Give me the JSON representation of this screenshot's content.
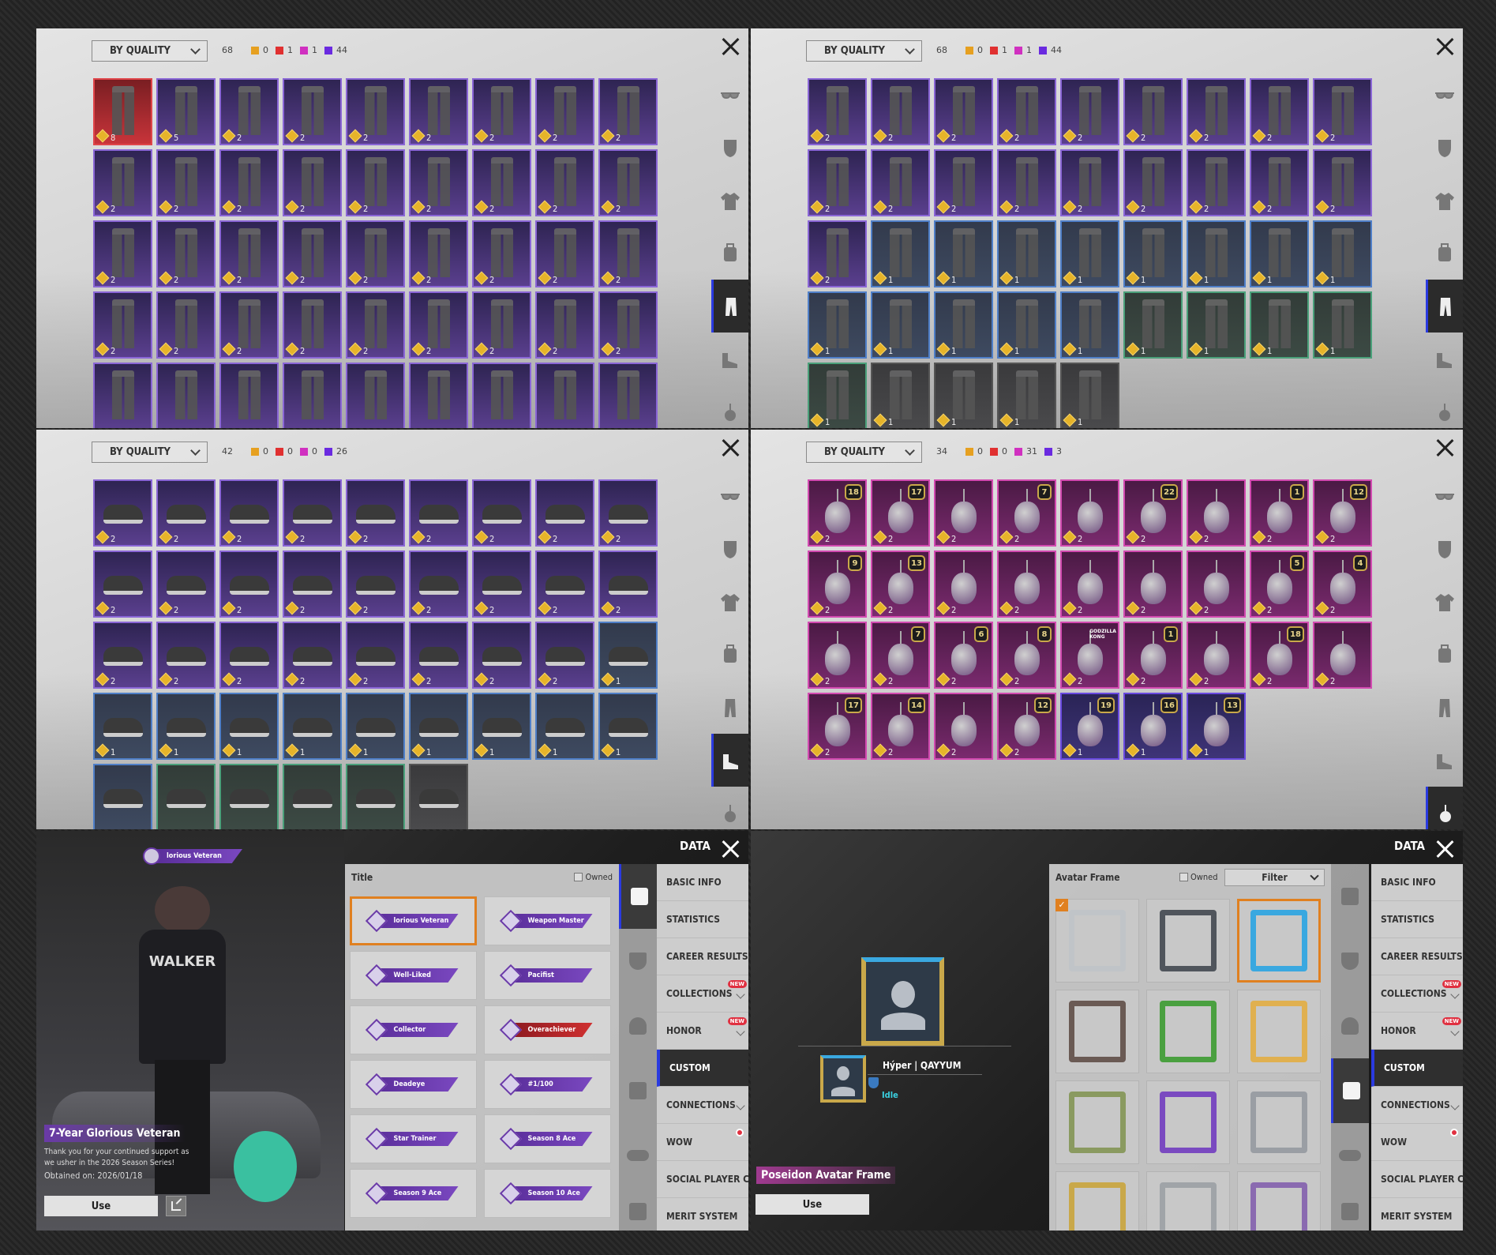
{
  "colors": {
    "accent": "#2a3ae0",
    "selected_border": "#e08020",
    "legend": [
      "#e6a020",
      "#e03030",
      "#d030c0",
      "#6a2ae0"
    ]
  },
  "side_icons": [
    "glasses-icon",
    "mask-icon",
    "jacket-icon",
    "backpack-icon",
    "pants-icon",
    "shoes-icon",
    "pendant-icon"
  ],
  "inventory_panels": [
    {
      "sort_label": "BY QUALITY",
      "total": "68",
      "counts": [
        "0",
        "1",
        "1",
        "44"
      ],
      "selected_category": 4,
      "kind": "pants",
      "items": [
        {
          "q": "r",
          "n": "8"
        },
        {
          "q": "p",
          "n": "5"
        },
        {
          "q": "p",
          "n": "2"
        },
        {
          "q": "p",
          "n": "2"
        },
        {
          "q": "p",
          "n": "2"
        },
        {
          "q": "p",
          "n": "2"
        },
        {
          "q": "p",
          "n": "2"
        },
        {
          "q": "p",
          "n": "2"
        },
        {
          "q": "p",
          "n": "2"
        },
        {
          "q": "p",
          "n": "2"
        },
        {
          "q": "p",
          "n": "2"
        },
        {
          "q": "p",
          "n": "2"
        },
        {
          "q": "p",
          "n": "2"
        },
        {
          "q": "p",
          "n": "2"
        },
        {
          "q": "p",
          "n": "2"
        },
        {
          "q": "p",
          "n": "2"
        },
        {
          "q": "p",
          "n": "2"
        },
        {
          "q": "p",
          "n": "2"
        },
        {
          "q": "p",
          "n": "2"
        },
        {
          "q": "p",
          "n": "2"
        },
        {
          "q": "p",
          "n": "2"
        },
        {
          "q": "p",
          "n": "2"
        },
        {
          "q": "p",
          "n": "2"
        },
        {
          "q": "p",
          "n": "2"
        },
        {
          "q": "p",
          "n": "2"
        },
        {
          "q": "p",
          "n": "2"
        },
        {
          "q": "p",
          "n": "2"
        },
        {
          "q": "p",
          "n": "2"
        },
        {
          "q": "p",
          "n": "2"
        },
        {
          "q": "p",
          "n": "2"
        },
        {
          "q": "p",
          "n": "2"
        },
        {
          "q": "p",
          "n": "2"
        },
        {
          "q": "p",
          "n": "2"
        },
        {
          "q": "p",
          "n": "2"
        },
        {
          "q": "p",
          "n": "2"
        },
        {
          "q": "p",
          "n": "2"
        },
        {
          "q": "p"
        },
        {
          "q": "p"
        },
        {
          "q": "p"
        },
        {
          "q": "p"
        },
        {
          "q": "p"
        },
        {
          "q": "p"
        },
        {
          "q": "p"
        },
        {
          "q": "p"
        },
        {
          "q": "p"
        }
      ]
    },
    {
      "sort_label": "BY QUALITY",
      "total": "68",
      "counts": [
        "0",
        "1",
        "1",
        "44"
      ],
      "selected_category": 4,
      "kind": "pants",
      "items": [
        {
          "q": "p",
          "n": "2"
        },
        {
          "q": "p",
          "n": "2"
        },
        {
          "q": "p",
          "n": "2"
        },
        {
          "q": "p",
          "n": "2"
        },
        {
          "q": "p",
          "n": "2"
        },
        {
          "q": "p",
          "n": "2"
        },
        {
          "q": "p",
          "n": "2"
        },
        {
          "q": "p",
          "n": "2"
        },
        {
          "q": "p",
          "n": "2"
        },
        {
          "q": "p",
          "n": "2"
        },
        {
          "q": "p",
          "n": "2"
        },
        {
          "q": "p",
          "n": "2"
        },
        {
          "q": "p",
          "n": "2"
        },
        {
          "q": "p",
          "n": "2"
        },
        {
          "q": "p",
          "n": "2"
        },
        {
          "q": "p",
          "n": "2"
        },
        {
          "q": "p",
          "n": "2"
        },
        {
          "q": "p",
          "n": "2"
        },
        {
          "q": "p",
          "n": "2"
        },
        {
          "q": "b",
          "n": "1"
        },
        {
          "q": "b",
          "n": "1"
        },
        {
          "q": "b",
          "n": "1"
        },
        {
          "q": "b",
          "n": "1"
        },
        {
          "q": "b",
          "n": "1"
        },
        {
          "q": "b",
          "n": "1"
        },
        {
          "q": "b",
          "n": "1"
        },
        {
          "q": "b",
          "n": "1"
        },
        {
          "q": "b",
          "n": "1"
        },
        {
          "q": "b",
          "n": "1"
        },
        {
          "q": "b",
          "n": "1"
        },
        {
          "q": "b",
          "n": "1"
        },
        {
          "q": "b",
          "n": "1"
        },
        {
          "q": "g",
          "n": "1"
        },
        {
          "q": "g",
          "n": "1"
        },
        {
          "q": "g",
          "n": "1"
        },
        {
          "q": "g",
          "n": "1"
        },
        {
          "q": "g",
          "n": "1"
        },
        {
          "q": "x",
          "n": "1"
        },
        {
          "q": "x",
          "n": "1"
        },
        {
          "q": "x",
          "n": "1"
        },
        {
          "q": "x",
          "n": "1"
        }
      ]
    },
    {
      "sort_label": "BY QUALITY",
      "total": "42",
      "counts": [
        "0",
        "0",
        "0",
        "26"
      ],
      "selected_category": 5,
      "kind": "shoes",
      "items": [
        {
          "q": "p",
          "n": "2"
        },
        {
          "q": "p",
          "n": "2"
        },
        {
          "q": "p",
          "n": "2"
        },
        {
          "q": "p",
          "n": "2"
        },
        {
          "q": "p",
          "n": "2"
        },
        {
          "q": "p",
          "n": "2"
        },
        {
          "q": "p",
          "n": "2"
        },
        {
          "q": "p",
          "n": "2"
        },
        {
          "q": "p",
          "n": "2"
        },
        {
          "q": "p",
          "n": "2"
        },
        {
          "q": "p",
          "n": "2"
        },
        {
          "q": "p",
          "n": "2"
        },
        {
          "q": "p",
          "n": "2"
        },
        {
          "q": "p",
          "n": "2"
        },
        {
          "q": "p",
          "n": "2"
        },
        {
          "q": "p",
          "n": "2"
        },
        {
          "q": "p",
          "n": "2"
        },
        {
          "q": "p",
          "n": "2"
        },
        {
          "q": "p",
          "n": "2"
        },
        {
          "q": "p",
          "n": "2"
        },
        {
          "q": "p",
          "n": "2"
        },
        {
          "q": "p",
          "n": "2"
        },
        {
          "q": "p",
          "n": "2"
        },
        {
          "q": "p",
          "n": "2"
        },
        {
          "q": "p",
          "n": "2"
        },
        {
          "q": "p",
          "n": "2"
        },
        {
          "q": "b",
          "n": "1"
        },
        {
          "q": "b",
          "n": "1"
        },
        {
          "q": "b",
          "n": "1"
        },
        {
          "q": "b",
          "n": "1"
        },
        {
          "q": "b",
          "n": "1"
        },
        {
          "q": "b",
          "n": "1"
        },
        {
          "q": "b",
          "n": "1"
        },
        {
          "q": "b",
          "n": "1"
        },
        {
          "q": "b",
          "n": "1"
        },
        {
          "q": "b",
          "n": "1"
        },
        {
          "q": "b"
        },
        {
          "q": "g"
        },
        {
          "q": "g"
        },
        {
          "q": "g"
        },
        {
          "q": "g"
        },
        {
          "q": "x"
        }
      ]
    },
    {
      "sort_label": "BY QUALITY",
      "total": "34",
      "counts": [
        "0",
        "0",
        "31",
        "3"
      ],
      "selected_category": 6,
      "kind": "pendant",
      "items": [
        {
          "q": "m",
          "n": "2",
          "badge": "18"
        },
        {
          "q": "m",
          "n": "2",
          "badge": "17"
        },
        {
          "q": "m",
          "n": "2"
        },
        {
          "q": "m",
          "n": "2",
          "badge": "7"
        },
        {
          "q": "m",
          "n": "2"
        },
        {
          "q": "m",
          "n": "2",
          "badge": "22"
        },
        {
          "q": "m",
          "n": "2"
        },
        {
          "q": "m",
          "n": "2",
          "badge": "1"
        },
        {
          "q": "m",
          "n": "2",
          "badge": "12"
        },
        {
          "q": "m",
          "n": "2",
          "badge": "9"
        },
        {
          "q": "m",
          "n": "2",
          "badge": "13"
        },
        {
          "q": "m",
          "n": "2"
        },
        {
          "q": "m",
          "n": "2"
        },
        {
          "q": "m",
          "n": "2"
        },
        {
          "q": "m",
          "n": "2"
        },
        {
          "q": "m",
          "n": "2"
        },
        {
          "q": "m",
          "n": "2",
          "badge": "5"
        },
        {
          "q": "m",
          "n": "2",
          "badge": "4"
        },
        {
          "q": "m",
          "n": "2"
        },
        {
          "q": "m",
          "n": "2",
          "badge": "7"
        },
        {
          "q": "m",
          "n": "2",
          "badge": "6"
        },
        {
          "q": "m",
          "n": "2",
          "badge": "8"
        },
        {
          "q": "m",
          "n": "2",
          "badge": "GODZILLA KONG"
        },
        {
          "q": "m",
          "n": "2",
          "badge": "1"
        },
        {
          "q": "m",
          "n": "2"
        },
        {
          "q": "m",
          "n": "2",
          "badge": "18"
        },
        {
          "q": "m",
          "n": "2"
        },
        {
          "q": "m",
          "n": "2",
          "badge": "17"
        },
        {
          "q": "m",
          "n": "2",
          "badge": "14"
        },
        {
          "q": "m",
          "n": "2"
        },
        {
          "q": "m",
          "n": "2",
          "badge": "12"
        },
        {
          "q": "v",
          "n": "1",
          "badge": "19"
        },
        {
          "q": "v",
          "n": "1",
          "badge": "16"
        },
        {
          "q": "v",
          "n": "1",
          "badge": "13"
        }
      ]
    }
  ],
  "profile_menu": {
    "data_label": "DATA",
    "items": [
      {
        "label": "BASIC INFO"
      },
      {
        "label": "STATISTICS"
      },
      {
        "label": "CAREER RESULTS"
      },
      {
        "label": "COLLECTIONS",
        "new": "NEW",
        "chevron": true
      },
      {
        "label": "HONOR",
        "new": "NEW",
        "chevron": true
      },
      {
        "label": "CUSTOM",
        "selected": true
      },
      {
        "label": "CONNECTIONS",
        "chevron": true
      },
      {
        "label": "WOW",
        "dot": true
      },
      {
        "label": "SOCIAL PLAYER CARD"
      },
      {
        "label": "MERIT SYSTEM"
      }
    ]
  },
  "title_panel": {
    "badge_preview": "lorious Veteran",
    "header": "Title",
    "owned_label": "Owned",
    "titles": [
      {
        "label": "lorious Veteran",
        "selected": true
      },
      {
        "label": "Weapon Master"
      },
      {
        "label": "Well-Liked"
      },
      {
        "label": "Pacifist"
      },
      {
        "label": "Collector"
      },
      {
        "label": "Overachiever",
        "red": true
      },
      {
        "label": "Deadeye"
      },
      {
        "label": "#1/100"
      },
      {
        "label": "Star Trainer"
      },
      {
        "label": "Season 8 Ace"
      },
      {
        "label": "Season 9 Ace"
      },
      {
        "label": "Season 10 Ace"
      }
    ],
    "selected_name": "7-Year Glorious Veteran",
    "desc_line1": "Thank you for your continued support as",
    "desc_line2": "we usher in the 2026 Season Series!",
    "obtained": "Obtained on: 2026/01/18",
    "use_label": "Use",
    "character_text": "WALKER"
  },
  "frame_panel": {
    "header": "Avatar Frame",
    "owned_label": "Owned",
    "filter_label": "Filter",
    "player_name": "Hýper | QAYYUM",
    "status": "Idle",
    "selected_name": "Poseidon Avatar Frame",
    "use_label": "Use",
    "frames": [
      {
        "color": "#c0c4c8",
        "checked": true
      },
      {
        "color": "#50555c"
      },
      {
        "color": "#3aa8e0",
        "selected": true
      },
      {
        "color": "#6a5a54"
      },
      {
        "color": "#4aa040"
      },
      {
        "color": "#e0b050"
      },
      {
        "color": "#8a9a60"
      },
      {
        "color": "#7a4ac0"
      },
      {
        "color": "#9a9ea4"
      },
      {
        "color": "#c9a84a"
      },
      {
        "color": "#a0a4a8"
      },
      {
        "color": "#8a6ab0"
      }
    ]
  }
}
